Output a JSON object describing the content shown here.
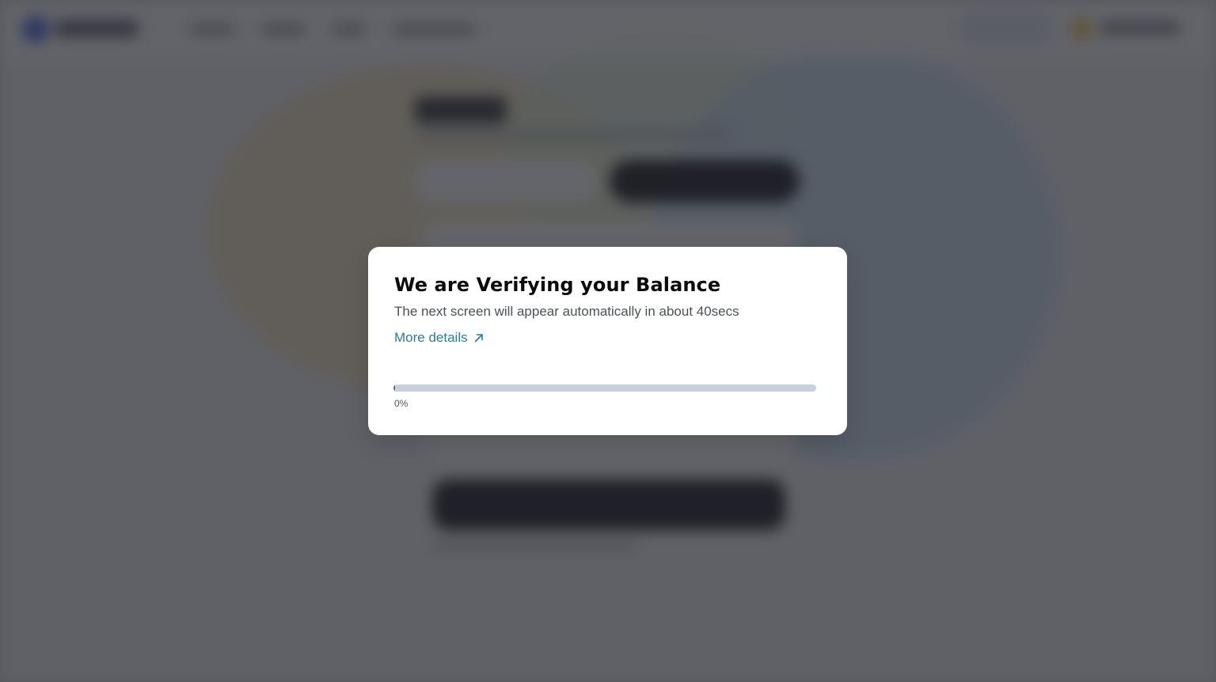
{
  "modal": {
    "title": "We are Verifying your Balance",
    "subtitle": "The next screen will appear automatically in about 40secs",
    "details_link": {
      "label": "More details",
      "icon": "arrow-up-right-icon"
    },
    "progress": {
      "value_percent": 0,
      "label": "0%"
    }
  },
  "colors": {
    "link": "#2f7aa1",
    "progress_track": "#c7d0dc",
    "progress_fill": "#5d6673",
    "overlay": "#3b3d42"
  }
}
